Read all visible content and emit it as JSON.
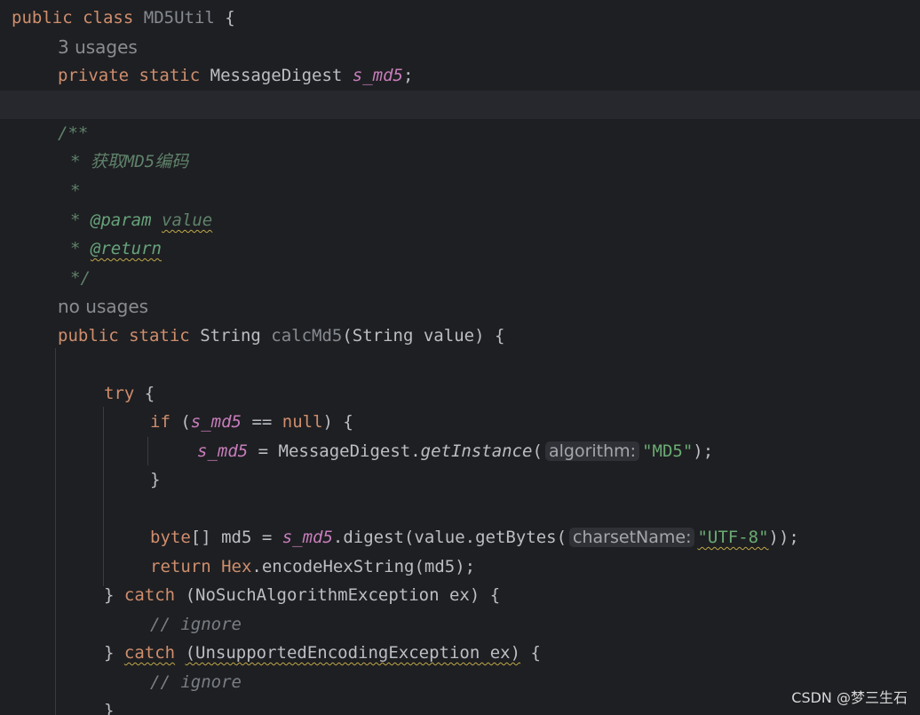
{
  "editor": {
    "code": {
      "l1_public": "public",
      "l1_class": "class",
      "l1_name": "MD5Util",
      "l1_brace": "{",
      "l2_usage": "3 usages",
      "l3_private": "private",
      "l3_static": "static",
      "l3_type": "MessageDigest",
      "l3_field": "s_md5",
      "l3_semi": ";",
      "l5_open": "/**",
      "l6_star": "*",
      "l6_desc": "获取MD5编码",
      "l7_star": "*",
      "l8_star": "*",
      "l8_tag": "@param",
      "l8_value": "value",
      "l9_star": "*",
      "l9_tag": "@return",
      "l10_close": "*/",
      "l11_usage": "no usages",
      "l12_public": "public",
      "l12_static": "static",
      "l12_type": "String",
      "l12_method": "calcMd5",
      "l12_params": "(String value) {",
      "l14_try": "try",
      "l14_brace": "{",
      "l15_if": "if",
      "l15_open": "(",
      "l15_field": "s_md5",
      "l15_eq": " == ",
      "l15_null": "null",
      "l15_close": ") {",
      "l16_field": "s_md5",
      "l16_assign": " = MessageDigest.",
      "l16_call": "getInstance",
      "l16_paren": "(",
      "l16_hint": "algorithm:",
      "l16_str": "\"MD5\"",
      "l16_end": ");",
      "l17_brace": "}",
      "l19_byte": "byte",
      "l19_arr": "[] md5 = ",
      "l19_field": "s_md5",
      "l19_call": ".digest(value.getBytes(",
      "l19_hint": "charsetName:",
      "l19_str": "\"UTF-8\"",
      "l19_end": "));",
      "l20_return": "return",
      "l20_hex": "Hex",
      "l20_call": ".encodeHexString(md5);",
      "l21_brace": "}",
      "l21_catch": "catch",
      "l21_rest": "(NoSuchAlgorithmException ex) {",
      "l22_comment": "// ignore",
      "l23_brace": "}",
      "l23_catch": "catch",
      "l23_params": "(UnsupportedEncodingException ex)",
      "l23_brace2": "{",
      "l24_comment": "// ignore",
      "l25_brace": "}"
    }
  },
  "watermark": "CSDN @梦三生石"
}
